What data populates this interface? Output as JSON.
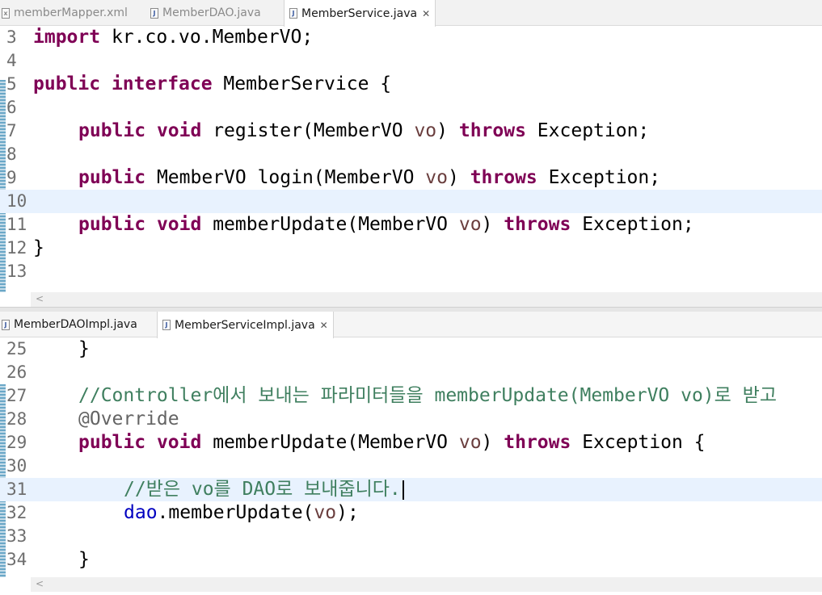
{
  "top_editor": {
    "tabs": [
      {
        "label": "memberMapper.xml"
      },
      {
        "label": "MemberDAO.java"
      },
      {
        "label": "MemberService.java"
      }
    ],
    "lines": [
      {
        "n": "3",
        "t": [
          "import",
          " kr.co.vo.MemberVO;"
        ]
      },
      {
        "n": "4"
      },
      {
        "n": "5",
        "t": [
          "public",
          " ",
          "interface",
          " MemberService {"
        ]
      },
      {
        "n": "6"
      },
      {
        "n": "7",
        "t": [
          "public",
          " ",
          "void",
          " register(MemberVO ",
          "vo",
          ") ",
          "throws",
          " Exception;"
        ]
      },
      {
        "n": "8"
      },
      {
        "n": "9",
        "t": [
          "public",
          " MemberVO login(MemberVO ",
          "vo",
          ") ",
          "throws",
          " Exception;"
        ]
      },
      {
        "n": "10"
      },
      {
        "n": "11",
        "t": [
          "public",
          " ",
          "void",
          " memberUpdate(MemberVO ",
          "vo",
          ") ",
          "throws",
          " Exception;"
        ]
      },
      {
        "n": "12",
        "t": [
          "}"
        ]
      },
      {
        "n": "13"
      }
    ],
    "scroll_arrow": "<"
  },
  "bottom_editor": {
    "tabs": [
      {
        "label": "MemberDAOImpl.java"
      },
      {
        "label": "MemberServiceImpl.java"
      }
    ],
    "lines": [
      {
        "n": "25",
        "t": [
          "}"
        ]
      },
      {
        "n": "26"
      },
      {
        "n": "27",
        "t": [
          "//Controller에서 보내는 파라미터들을 memberUpdate(MemberVO vo)로 받고"
        ]
      },
      {
        "n": "28",
        "t": [
          "@Override"
        ]
      },
      {
        "n": "29",
        "t": [
          "public",
          " ",
          "void",
          " memberUpdate(MemberVO ",
          "vo",
          ") ",
          "throws",
          " Exception {"
        ]
      },
      {
        "n": "30"
      },
      {
        "n": "31",
        "t": [
          "//받은 vo를 DAO로 보내줍니다."
        ]
      },
      {
        "n": "32",
        "t": [
          "dao",
          ".memberUpdate(",
          "vo",
          ");"
        ]
      },
      {
        "n": "33"
      },
      {
        "n": "34",
        "t": [
          "}"
        ]
      }
    ],
    "scroll_arrow": "<"
  },
  "colors": {
    "keyword": "#7f0055",
    "comment": "#3f7f5f",
    "parameter": "#6a3e3e",
    "field": "#0000c0",
    "annotation": "#646464",
    "current_line": "#e8f2fe"
  }
}
